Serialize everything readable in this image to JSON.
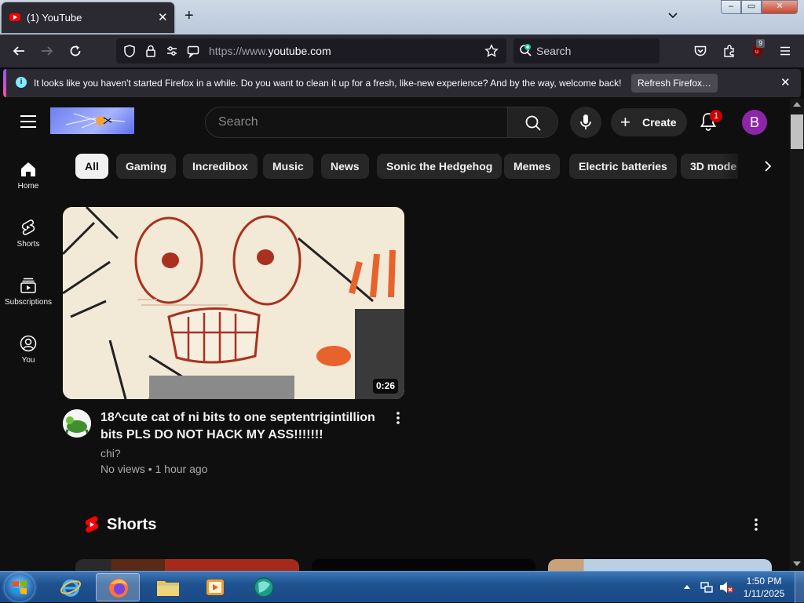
{
  "browser": {
    "tab": {
      "title": "(1) YouTube",
      "close": "✕"
    },
    "new_tab": "+",
    "window_buttons": {
      "minimize": "–",
      "maximize": "▭",
      "close": "✕"
    },
    "url": {
      "scheme": "https://www.",
      "host": "youtube.com"
    },
    "search_placeholder": "Search",
    "extension_badge": "9"
  },
  "notification": {
    "icon": "i",
    "message": "It looks like you haven't started Firefox in a while. Do you want to clean it up for a fresh, like-new experience? And by the way, welcome back!",
    "button": "Refresh Firefox…",
    "close": "✕"
  },
  "youtube": {
    "search_placeholder": "Search",
    "create_label": "Create",
    "create_plus": "+",
    "notification_count": "1",
    "avatar_letter": "B",
    "sidebar": [
      {
        "label": "Home"
      },
      {
        "label": "Shorts"
      },
      {
        "label": "Subscriptions"
      },
      {
        "label": "You"
      }
    ],
    "chips": [
      {
        "label": "All",
        "active": true
      },
      {
        "label": "Gaming"
      },
      {
        "label": "Incredibox"
      },
      {
        "label": "Music"
      },
      {
        "label": "News"
      },
      {
        "label": "Sonic the Hedgehog"
      },
      {
        "label": "Memes"
      },
      {
        "label": "Electric batteries"
      },
      {
        "label": "3D mode"
      }
    ],
    "video": {
      "duration": "0:26",
      "title": "18^cute cat of ni bits to one septentrigintillion bits PLS DO NOT HACK MY ASS!!!!!!!",
      "channel": "chi?",
      "views": "No views",
      "separator": "•",
      "age": "1 hour ago"
    },
    "shorts_title": "Shorts"
  },
  "taskbar": {
    "time": "1:50 PM",
    "date": "1/11/2025"
  },
  "colors": {
    "youtube_bg": "#0f0f0f",
    "chip_bg": "#272727",
    "badge_red": "#cc0000",
    "avatar": "#8e24aa",
    "firefox_toolbar": "#2b2a33"
  }
}
